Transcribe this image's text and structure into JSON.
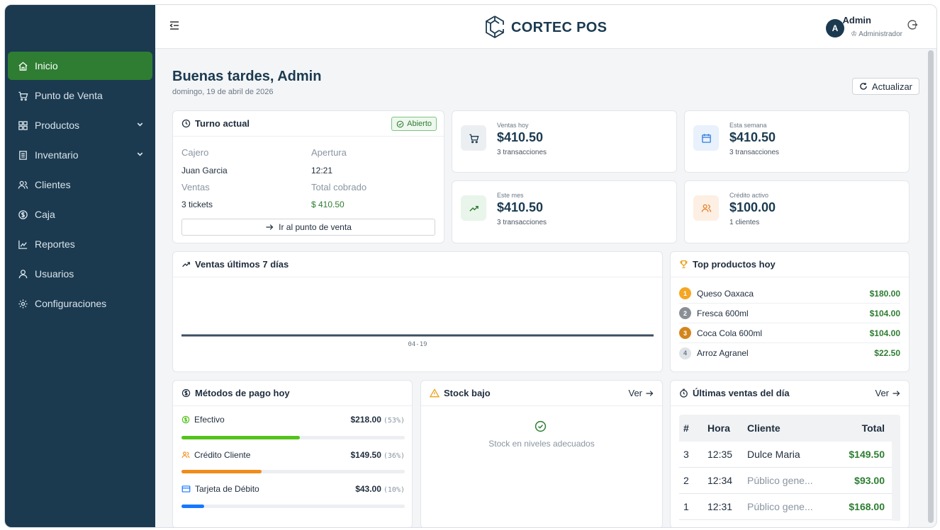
{
  "app": {
    "brand": "CORTEC POS"
  },
  "user": {
    "initial": "A",
    "name": "Admin",
    "role": "Administrador"
  },
  "sidebar": {
    "items": [
      {
        "label": "Inicio",
        "icon": "home-icon",
        "active": true
      },
      {
        "label": "Punto de Venta",
        "icon": "cart-icon"
      },
      {
        "label": "Productos",
        "icon": "grid-icon",
        "expandable": true
      },
      {
        "label": "Inventario",
        "icon": "clipboard-icon",
        "expandable": true
      },
      {
        "label": "Clientes",
        "icon": "users-icon"
      },
      {
        "label": "Caja",
        "icon": "dollar-circle-icon"
      },
      {
        "label": "Reportes",
        "icon": "chart-icon"
      },
      {
        "label": "Usuarios",
        "icon": "user-icon"
      },
      {
        "label": "Configuraciones",
        "icon": "gear-icon"
      }
    ]
  },
  "header": {
    "greeting": "Buenas tardes, Admin",
    "date": "domingo, 19 de abril de 2026",
    "refresh_label": "Actualizar"
  },
  "shift": {
    "title": "Turno actual",
    "status": "Abierto",
    "cashier_label": "Cajero",
    "cashier": "Juan Garcia",
    "opening_label": "Apertura",
    "opening": "12:21",
    "sales_label": "Ventas",
    "sales": "3 tickets",
    "total_label": "Total cobrado",
    "total": "$ 410.50",
    "pos_button": "Ir al punto de venta"
  },
  "stats": [
    {
      "label": "Ventas hoy",
      "value": "$410.50",
      "sub": "3 transacciones",
      "icon": "cart-icon",
      "bg": "#eceff2",
      "fg": "#1b3a50"
    },
    {
      "label": "Esta semana",
      "value": "$410.50",
      "sub": "3 transacciones",
      "icon": "calendar-icon",
      "bg": "#e8f1fc",
      "fg": "#2f7de1"
    },
    {
      "label": "Este mes",
      "value": "$410.50",
      "sub": "3 transacciones",
      "icon": "trend-up-icon",
      "bg": "#e9f5eb",
      "fg": "#2e7d32"
    },
    {
      "label": "Crédito activo",
      "value": "$100.00",
      "sub": "1 clientes",
      "icon": "users-icon",
      "bg": "#fdefe3",
      "fg": "#e8812b"
    }
  ],
  "sales_chart": {
    "title": "Ventas últimos 7 días"
  },
  "chart_data": {
    "type": "line",
    "title": "",
    "x": [
      "04-19"
    ],
    "series": [
      {
        "values": [
          410.5
        ]
      }
    ],
    "xlabel": "",
    "ylabel": ""
  },
  "top_products": {
    "title": "Top productos hoy",
    "items": [
      {
        "rank": "1",
        "name": "Queso Oaxaca",
        "amount": "$180.00",
        "color": "#f5a623"
      },
      {
        "rank": "2",
        "name": "Fresca 600ml",
        "amount": "$104.00",
        "color": "#8a8f96"
      },
      {
        "rank": "3",
        "name": "Coca Cola 600ml",
        "amount": "$104.00",
        "color": "#d4861c"
      },
      {
        "rank": "4",
        "name": "Arroz Agranel",
        "amount": "$22.50",
        "color": "#dfe3e8"
      }
    ]
  },
  "payments": {
    "title": "Métodos de pago hoy",
    "items": [
      {
        "label": "Efectivo",
        "amount": "$218.00",
        "pct": "(53%)",
        "fraction": 0.53,
        "color": "#52c41a",
        "icon": "dollar-circle-icon"
      },
      {
        "label": "Crédito Cliente",
        "amount": "$149.50",
        "pct": "(36%)",
        "fraction": 0.36,
        "color": "#f08c1a",
        "icon": "users-icon"
      },
      {
        "label": "Tarjeta de Débito",
        "amount": "$43.00",
        "pct": "(10%)",
        "fraction": 0.1,
        "color": "#1677ff",
        "icon": "card-icon"
      }
    ]
  },
  "stock": {
    "title": "Stock bajo",
    "link": "Ver",
    "empty": "Stock en niveles adecuados"
  },
  "recent_sales": {
    "title": "Últimas ventas del día",
    "link": "Ver",
    "columns": [
      "#",
      "Hora",
      "Cliente",
      "Total"
    ],
    "rows": [
      {
        "n": "3",
        "time": "12:35",
        "client": "Dulce Maria",
        "total": "$149.50",
        "muted": false
      },
      {
        "n": "2",
        "time": "12:34",
        "client": "Público gene...",
        "total": "$93.00",
        "muted": true
      },
      {
        "n": "1",
        "time": "12:31",
        "client": "Público gene...",
        "total": "$168.00",
        "muted": true
      }
    ]
  }
}
